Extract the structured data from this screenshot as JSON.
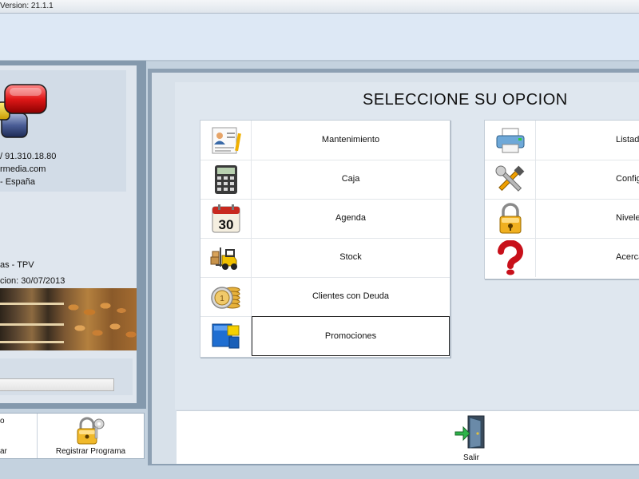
{
  "window": {
    "title": "Version: 21.1.1"
  },
  "company": {
    "phone": "/ 91.310.18.80",
    "web": "rmedia.com",
    "country": "- España"
  },
  "program": {
    "name": "as - TPV",
    "version_date": "cion: 30/07/2013"
  },
  "left_toolbar": {
    "partial_top": "o",
    "partial_label": "ar",
    "register_label": "Registrar Programa"
  },
  "main": {
    "heading": "SELECCIONE SU OPCION",
    "left_menu": [
      {
        "label": "Mantenimiento",
        "icon": "contact-card-icon"
      },
      {
        "label": "Caja",
        "icon": "calculator-icon"
      },
      {
        "label": "Agenda",
        "icon": "calendar-icon",
        "icon_text": "30"
      },
      {
        "label": "Stock",
        "icon": "forklift-icon"
      },
      {
        "label": "Clientes con Deuda",
        "icon": "coins-icon"
      },
      {
        "label": "Promociones",
        "icon": "cubes-icon"
      }
    ],
    "right_menu": [
      {
        "label": "Listad",
        "icon": "printer-icon"
      },
      {
        "label": "Configur",
        "icon": "tools-icon"
      },
      {
        "label": "Niveles de",
        "icon": "padlock-icon"
      },
      {
        "label": "Acerca",
        "icon": "question-icon"
      }
    ],
    "exit_label": "Salir"
  },
  "colors": {
    "title_bar": "#e6ebf0",
    "top_band": "#dde8f5",
    "panel_frame": "#8da0b3",
    "panel_bg": "#dfe7ef",
    "menu_bg": "#ffffff"
  }
}
